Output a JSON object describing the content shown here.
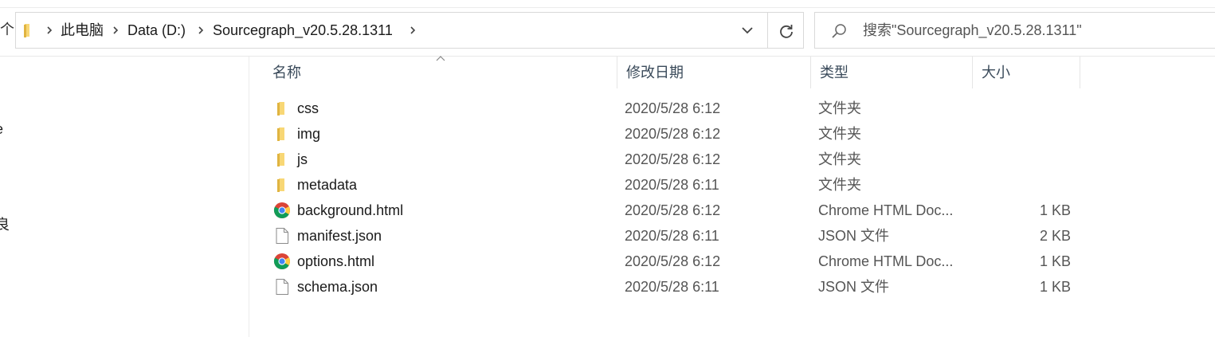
{
  "navigation": {
    "up_glyph": "个"
  },
  "breadcrumb": {
    "items": [
      "此电脑",
      "Data (D:)",
      "Sourcegraph_v20.5.28.1311"
    ],
    "folder_icon": "folder-icon",
    "separator_icon": "chevron-right-icon"
  },
  "address_bar": {
    "dropdown_icon": "chevron-down-icon",
    "refresh_icon": "refresh-icon"
  },
  "search": {
    "placeholder": "搜索\"Sourcegraph_v20.5.28.1311\"",
    "icon": "search-icon"
  },
  "nav_pane": {
    "fragments": [
      "e",
      "良"
    ]
  },
  "columns": {
    "name": "名称",
    "date_modified": "修改日期",
    "type": "类型",
    "size": "大小"
  },
  "files": [
    {
      "name": "css",
      "date": "2020/5/28 6:12",
      "type": "文件夹",
      "size": "",
      "icon": "folder-icon"
    },
    {
      "name": "img",
      "date": "2020/5/28 6:12",
      "type": "文件夹",
      "size": "",
      "icon": "folder-icon"
    },
    {
      "name": "js",
      "date": "2020/5/28 6:12",
      "type": "文件夹",
      "size": "",
      "icon": "folder-icon"
    },
    {
      "name": "metadata",
      "date": "2020/5/28 6:11",
      "type": "文件夹",
      "size": "",
      "icon": "folder-icon"
    },
    {
      "name": "background.html",
      "date": "2020/5/28 6:12",
      "type": "Chrome HTML Doc...",
      "size": "1 KB",
      "icon": "chrome-icon"
    },
    {
      "name": "manifest.json",
      "date": "2020/5/28 6:11",
      "type": "JSON 文件",
      "size": "2 KB",
      "icon": "file-icon"
    },
    {
      "name": "options.html",
      "date": "2020/5/28 6:12",
      "type": "Chrome HTML Doc...",
      "size": "1 KB",
      "icon": "chrome-icon"
    },
    {
      "name": "schema.json",
      "date": "2020/5/28 6:11",
      "type": "JSON 文件",
      "size": "1 KB",
      "icon": "file-icon"
    }
  ],
  "colors": {
    "folder_yellow": "#f8d775",
    "folder_dark": "#e0b441",
    "header_text": "#3a4a5a",
    "secondary_text": "#555555"
  }
}
